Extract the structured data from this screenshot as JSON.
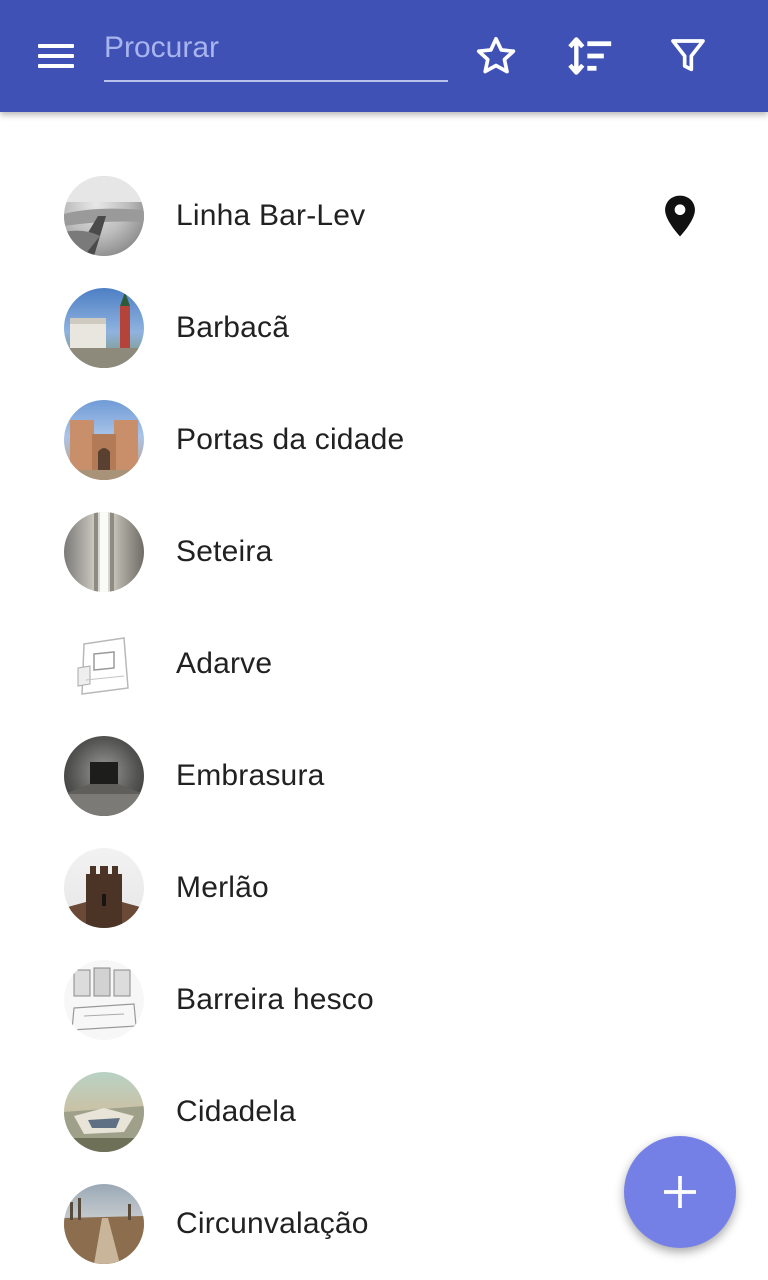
{
  "toolbar": {
    "search_placeholder": "Procurar",
    "icons": [
      "menu-icon",
      "star-outline-icon",
      "sort-icon",
      "filter-icon"
    ]
  },
  "list": {
    "items": [
      {
        "label": "Linha Bar-Lev",
        "thumbnail": "grayscale desert trench photo",
        "has_location": true
      },
      {
        "label": "Barbacã",
        "thumbnail": "fortress tower with blue sky"
      },
      {
        "label": "Portas da cidade",
        "thumbnail": "city gate towers"
      },
      {
        "label": "Seteira",
        "thumbnail": "stone arrow slit"
      },
      {
        "label": "Adarve",
        "thumbnail": "wall walk sketch"
      },
      {
        "label": "Embrasura",
        "thumbnail": "dark embrasure corridor"
      },
      {
        "label": "Merlão",
        "thumbnail": "crenellated castle tower"
      },
      {
        "label": "Barreira hesco",
        "thumbnail": "hesco barrier illustration"
      },
      {
        "label": "Cidadela",
        "thumbnail": "citadel painting"
      },
      {
        "label": "Circunvalação",
        "thumbnail": "trench line landscape"
      }
    ]
  },
  "fab": {
    "icon": "plus-icon"
  },
  "colors": {
    "appbar": "#3f51b5",
    "fab": "#7480e6",
    "text": "#212121"
  }
}
